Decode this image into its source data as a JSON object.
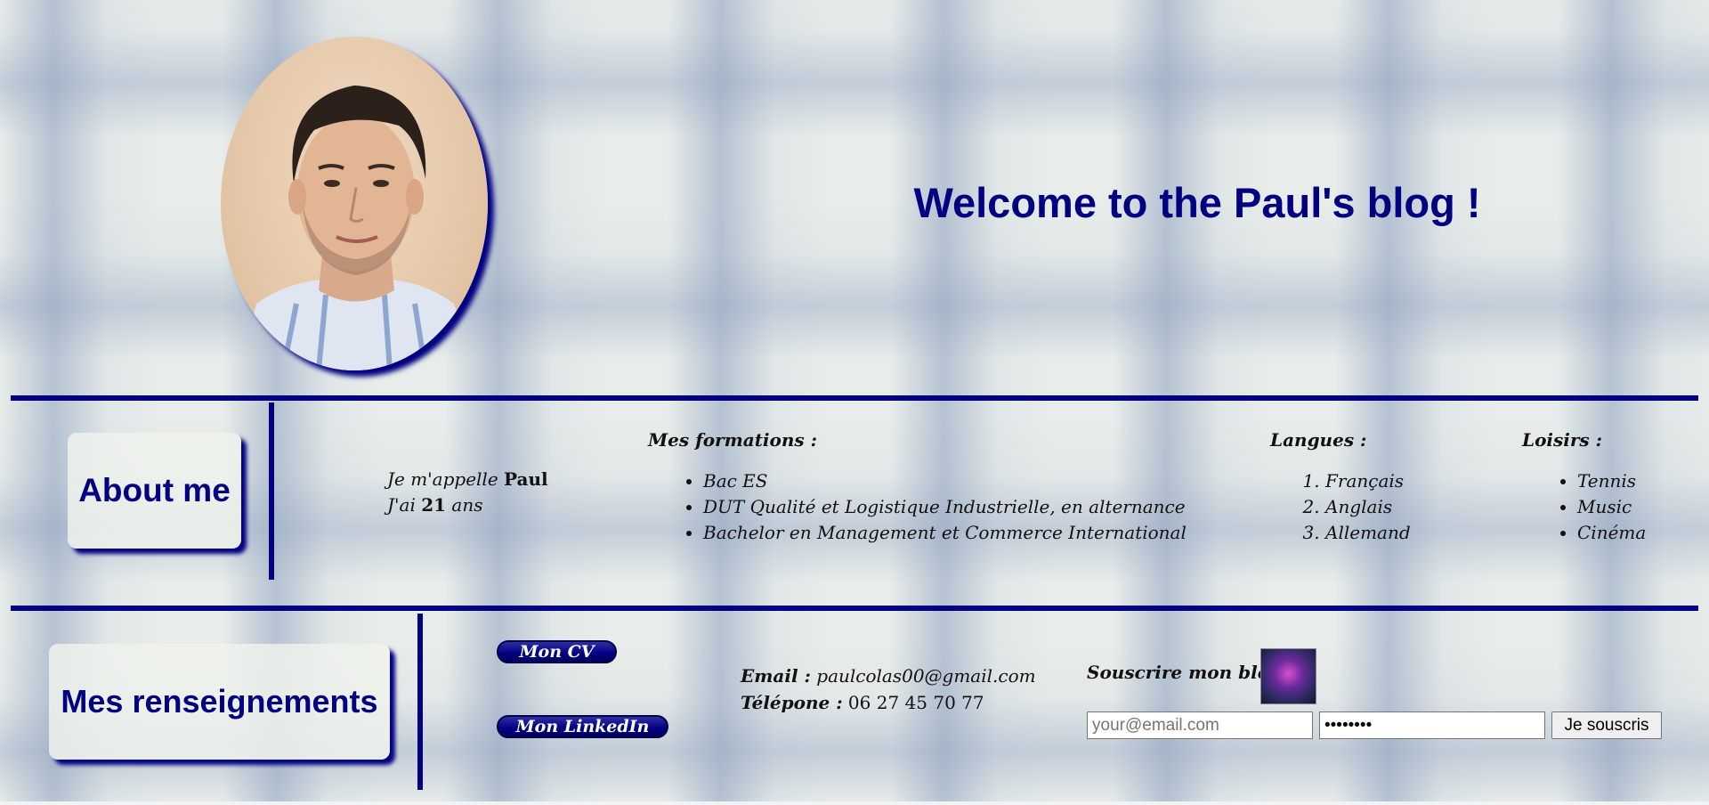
{
  "header": {
    "title": "Welcome to the Paul's blog !"
  },
  "about": {
    "section_title": "About me",
    "intro_line1_prefix": "Je m'appelle ",
    "intro_name": "Paul",
    "intro_line2_prefix": "J'ai ",
    "intro_age": "21",
    "intro_line2_suffix": " ans",
    "formations": {
      "label_prefix": "Mes ",
      "label_main": "formations",
      "label_suffix": " :",
      "items": [
        "Bac ES",
        "DUT Qualité et Logistique Industrielle, en alternance",
        "Bachelor en Management et Commerce International"
      ]
    },
    "langues": {
      "label": "Langues :",
      "items": [
        "Français",
        "Anglais",
        "Allemand"
      ]
    },
    "loisirs": {
      "label": "Loisirs :",
      "items": [
        "Tennis",
        "Music",
        "Cinéma"
      ]
    }
  },
  "renseignements": {
    "section_title": "Mes renseignements",
    "cv_label": "Mon CV",
    "linkedin_label": "Mon LinkedIn",
    "email_label": "Email :",
    "email_value": " paulcolas00@gmail.com",
    "phone_label": "Télépone :",
    "phone_value": " 06 27 45 70 77"
  },
  "subscribe": {
    "label": "Souscrire mon blog :",
    "email_placeholder": "your@email.com",
    "password_value": "••••••••",
    "button_label": "Je souscris"
  },
  "colors": {
    "accent": "#000080"
  }
}
